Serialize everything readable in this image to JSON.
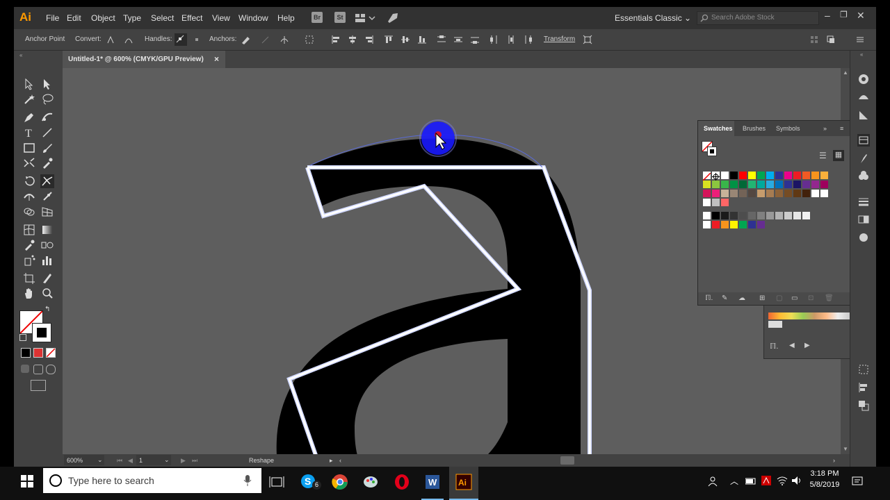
{
  "app": {
    "logo": "Ai",
    "menu": [
      "File",
      "Edit",
      "Object",
      "Type",
      "Select",
      "Effect",
      "View",
      "Window",
      "Help"
    ],
    "bridge_label": "Br",
    "stock_label": "St",
    "workspace": "Essentials Classic",
    "search_placeholder": "Search Adobe Stock"
  },
  "control_bar": {
    "anchor_point": "Anchor Point",
    "convert": "Convert:",
    "handles": "Handles:",
    "anchors": "Anchors:",
    "transform": "Transform"
  },
  "document": {
    "tab_title": "Untitled-1* @ 600% (CMYK/GPU Preview)",
    "close": "×"
  },
  "status": {
    "zoom": "600%",
    "artboard": "1",
    "tool": "Reshape"
  },
  "swatches_panel": {
    "tabs": [
      "Swatches",
      "Brushes",
      "Symbols"
    ],
    "rows": [
      [
        "none",
        "reg",
        "#ffffff",
        "#000000",
        "#ff0000",
        "#ffff00",
        "#00a651",
        "#00aeef",
        "#2e3192",
        "#ec008c",
        "#ed1c24",
        "#f15a24",
        "#f7941d",
        "#fbb03b"
      ],
      [
        "#d9e021",
        "#8cc63f",
        "#39b54a",
        "#009245",
        "#006837",
        "#22b573",
        "#00a99d",
        "#29abe2",
        "#0071bc",
        "#2e3192",
        "#1b1464",
        "#662d91",
        "#93278f",
        "#9e005d"
      ],
      [
        "#d4145a",
        "#ed1e79",
        "#c7b299",
        "#998675",
        "#736357",
        "#534741",
        "#c69c6d",
        "#a67c52",
        "#8c6239",
        "#754c24",
        "#603813",
        "#42210b",
        "#ffffff",
        "#ffffff"
      ],
      [
        "#ffffff",
        "#c0c0c0",
        "#ff6666"
      ],
      [
        "#ffffff",
        "#000000",
        "#1a1a1a",
        "#333333",
        "#4d4d4d",
        "#666666",
        "#808080",
        "#999999",
        "#b3b3b3",
        "#cccccc",
        "#e6e6e6",
        "#f2f2f2"
      ],
      [
        "#ffffff",
        "#ed1c24",
        "#f7941d",
        "#fff200",
        "#00a651",
        "#2e3192",
        "#662d91"
      ]
    ]
  },
  "taskbar": {
    "search_placeholder": "Type here to search",
    "skype_badge": "6",
    "time": "3:18 PM",
    "date": "5/8/2019"
  }
}
